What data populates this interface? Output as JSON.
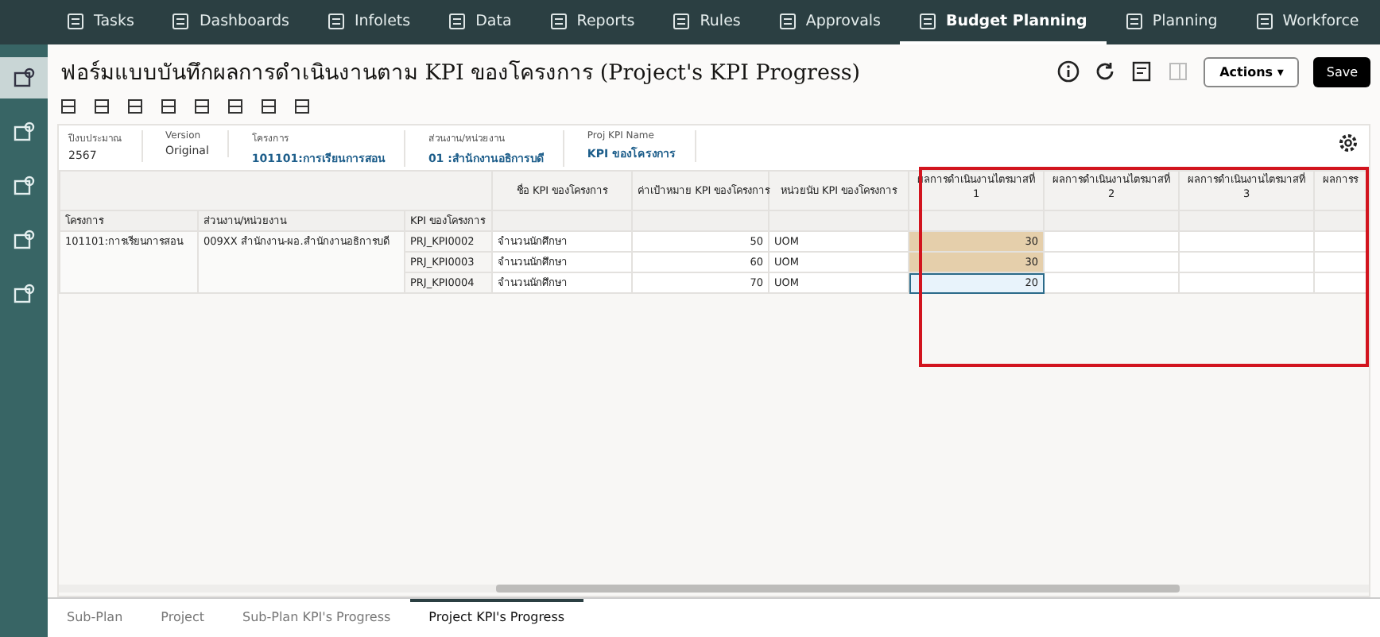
{
  "nav": [
    {
      "label": "Tasks",
      "selected": false
    },
    {
      "label": "Dashboards",
      "selected": false
    },
    {
      "label": "Infolets",
      "selected": false
    },
    {
      "label": "Data",
      "selected": false
    },
    {
      "label": "Reports",
      "selected": false
    },
    {
      "label": "Rules",
      "selected": false
    },
    {
      "label": "Approvals",
      "selected": false
    },
    {
      "label": "Budget Planning",
      "selected": true
    },
    {
      "label": "Planning",
      "selected": false
    },
    {
      "label": "Workforce",
      "selected": false
    }
  ],
  "sidebar": [
    {
      "selected": true
    },
    {
      "selected": false
    },
    {
      "selected": false
    },
    {
      "selected": false
    },
    {
      "selected": false
    }
  ],
  "title": "ฟอร์มแบบบันทึกผลการดำเนินงานตาม KPI ของโครงการ (Project's KPI Progress)",
  "actions_button": "Actions ▾",
  "save_button": "Save",
  "pov": [
    {
      "label": "ปีงบประมาณ",
      "value": "2567",
      "link": false
    },
    {
      "label": "Version",
      "value": "Original",
      "link": false
    },
    {
      "label": "โครงการ",
      "value": "101101:การเรียนการสอน",
      "link": true
    },
    {
      "label": "ส่วนงาน/หน่วยงาน",
      "value": "01 :สำนักงานอธิการบดี",
      "link": true
    },
    {
      "label": "Proj KPI Name",
      "value": "KPI ของโครงการ",
      "link": true
    }
  ],
  "grid": {
    "column_headers": [
      "ชื่อ KPI ของโครงการ",
      "ค่าเป้าหมาย KPI ของโครงการ",
      "หน่วยนับ KPI ของโครงการ",
      [
        "ผลการดำเนินงานไตรมาสที่",
        "1"
      ],
      [
        "ผลการดำเนินงานไตรมาสที่",
        "2"
      ],
      [
        "ผลการดำเนินงานไตรมาสที่",
        "3"
      ],
      [
        "ผลการร"
      ]
    ],
    "row_header_labels": [
      "โครงการ",
      "ส่วนงาน/หน่วยงาน",
      "KPI ของโครงการ"
    ],
    "project": "101101:การเรียนการสอน",
    "org": "009XX สำนักงาน-ผอ.สำนักงานอธิการบดี",
    "rows": [
      {
        "code": "PRJ_KPI0002",
        "name": "จำนวนนักศึกษา",
        "target": "50",
        "uom": "UOM",
        "cells": [
          {
            "value": "30",
            "modified": true,
            "selected": false
          },
          {
            "modified": false,
            "selected": false
          },
          {
            "modified": false,
            "selected": false
          },
          {
            "modified": false,
            "selected": false
          }
        ]
      },
      {
        "code": "PRJ_KPI0003",
        "name": "จำนวนนักศึกษา",
        "target": "60",
        "uom": "UOM",
        "cells": [
          {
            "value": "30",
            "modified": true,
            "selected": false
          },
          {
            "modified": false,
            "selected": false
          },
          {
            "modified": false,
            "selected": false
          },
          {
            "modified": false,
            "selected": false
          }
        ]
      },
      {
        "code": "PRJ_KPI0004",
        "name": "จำนวนนักศึกษา",
        "target": "70",
        "uom": "UOM",
        "cells": [
          {
            "value": "20",
            "modified": false,
            "selected": true
          },
          {
            "modified": false,
            "selected": false
          },
          {
            "modified": false,
            "selected": false
          },
          {
            "modified": false,
            "selected": false
          }
        ]
      }
    ]
  },
  "bottom_tabs": [
    {
      "label": "Sub-Plan",
      "selected": false
    },
    {
      "label": "Project",
      "selected": false
    },
    {
      "label": "Sub-Plan KPI's Progress",
      "selected": false
    },
    {
      "label": "Project KPI's Progress",
      "selected": true
    }
  ]
}
